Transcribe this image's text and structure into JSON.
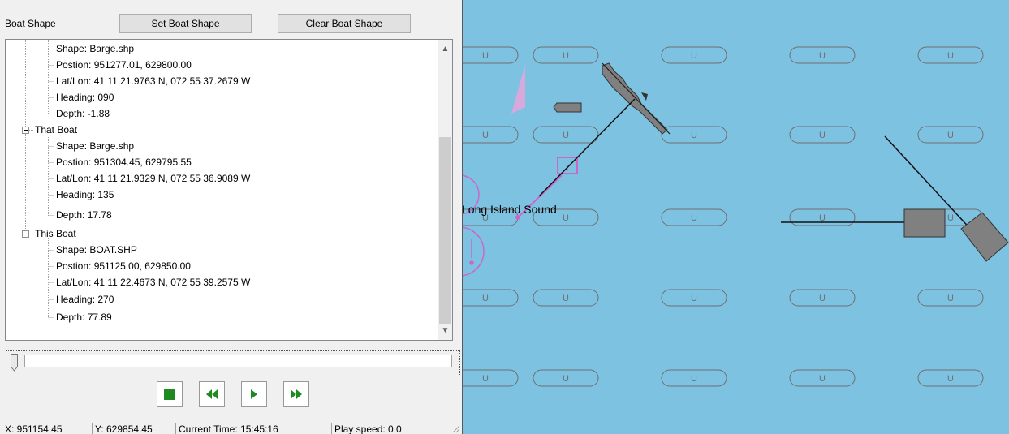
{
  "header": {
    "section_label": "Boat Shape",
    "set_button": "Set Boat Shape",
    "clear_button": "Clear Boat Shape"
  },
  "tree": {
    "rows": [
      "Shape: Barge.shp",
      "Postion: 951277.01, 629800.00",
      "Lat/Lon: 41 11 21.9763 N, 072 55 37.2679 W",
      "Heading: 090",
      "Depth: -1.88",
      "That Boat",
      "Shape: Barge.shp",
      "Postion: 951304.45, 629795.55",
      "Lat/Lon: 41 11 21.9329 N, 072 55 36.9089 W",
      "Heading: 135",
      "Depth: 17.78",
      "This Boat",
      "Shape: BOAT.SHP",
      "Postion: 951125.00, 629850.00",
      "Lat/Lon: 41 11 22.4673 N, 072 55 39.2575 W",
      "Heading: 270",
      "Depth: 77.89"
    ]
  },
  "status": {
    "x": "X: 951154.45",
    "y": "Y: 629854.45",
    "time": "Current Time: 15:45:16",
    "speed": "Play speed: 0.0"
  },
  "map": {
    "place_label": "Long Island Sound",
    "buoy_letter": "U",
    "colors": {
      "water": "#7ec2e2",
      "symbol": "#cc66cc",
      "vessel": "#808080"
    }
  },
  "icons": {
    "stop": "stop-icon",
    "rewind": "rewind-icon",
    "play": "play-icon",
    "fast_forward": "fast-forward-icon"
  }
}
